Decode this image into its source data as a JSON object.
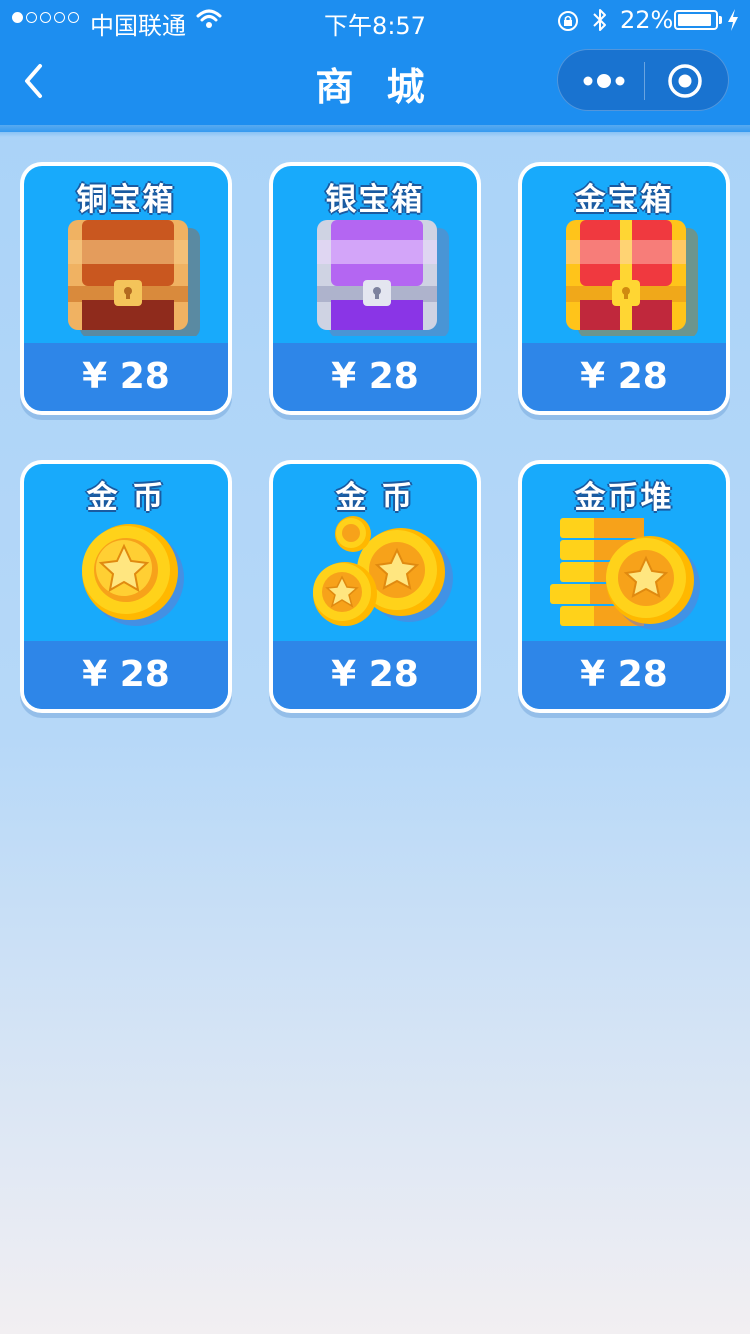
{
  "status_bar": {
    "carrier": "中国联通",
    "time": "下午8:57",
    "battery_percent": "22%",
    "battery_level": 0.22,
    "signal_bars_filled": 1,
    "signal_bars_total": 5
  },
  "nav": {
    "title": "商 城",
    "back_icon": "chevron-left-icon",
    "more_icon": "more-dots-icon",
    "close_icon": "target-circle-icon"
  },
  "products": [
    {
      "name": "铜宝箱",
      "price": "¥ 28",
      "icon": "bronze-chest-icon"
    },
    {
      "name": "银宝箱",
      "price": "¥ 28",
      "icon": "silver-chest-icon"
    },
    {
      "name": "金宝箱",
      "price": "¥ 28",
      "icon": "gold-chest-icon"
    },
    {
      "name": "金 币",
      "price": "¥ 28",
      "icon": "gold-coin-icon"
    },
    {
      "name": "金 币",
      "price": "¥ 28",
      "icon": "gold-coins-icon"
    },
    {
      "name": "金币堆",
      "price": "¥ 28",
      "icon": "gold-coin-pile-icon"
    }
  ],
  "colors": {
    "nav_bg": "#1d8ef0",
    "card_bg": "#18aafb",
    "price_bg": "#2e86e8",
    "page_bg_top": "#a8d2f8",
    "page_bg_bottom": "#f2eff2"
  }
}
